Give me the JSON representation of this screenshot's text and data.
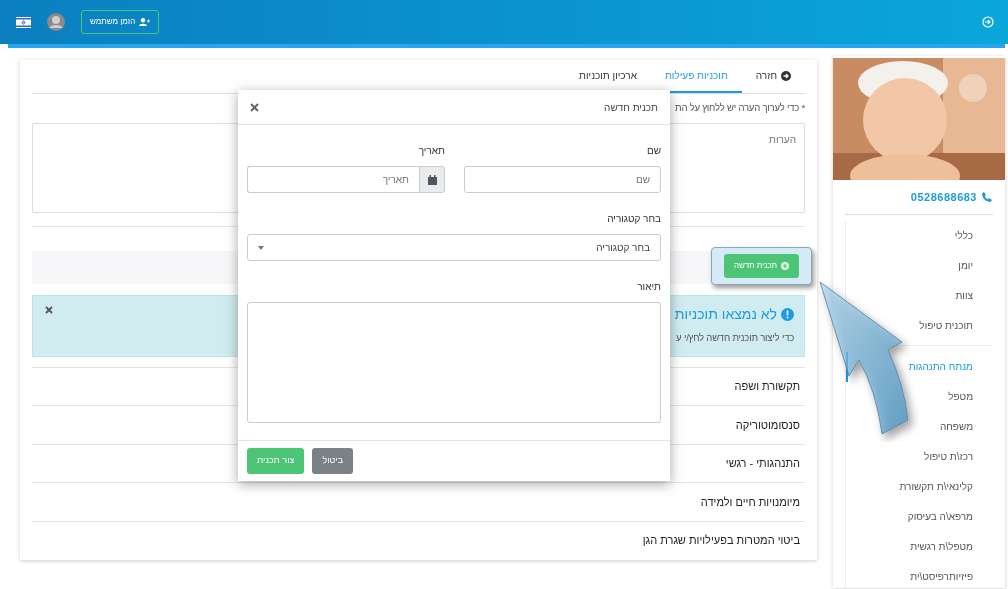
{
  "top_bar": {
    "invite_button": "הזמן משתמש"
  },
  "tabs": [
    {
      "label": "חזרה",
      "kind": "back",
      "selected": false
    },
    {
      "label": "תוכניות פעילות",
      "kind": "tab",
      "selected": true
    },
    {
      "label": "ארכיון תוכניות",
      "kind": "tab",
      "selected": false
    }
  ],
  "note": "* כדי לערוך הערה יש ללחוץ על הת",
  "notes_field": {
    "placeholder": "הערות"
  },
  "new_plan_button": "תכנית חדשה",
  "alert": {
    "title": "לא נמצאו תוכניות",
    "text": "כדי ליצור תוכנית חדשה לחץ/י ע"
  },
  "sections": [
    "תקשורת ושפה",
    "סנסומוטוריקה",
    "התנהגותי - רגשי",
    "מיומנויות חיים ולמידה",
    "ביטוי המטרות בפעילויות שגרת הגן"
  ],
  "sidebar": {
    "phone": "0528688683",
    "menu_groups": [
      {
        "items": [
          {
            "label": "כללי",
            "selected": false
          },
          {
            "label": "יומן",
            "selected": false
          },
          {
            "label": "צוות",
            "selected": false
          },
          {
            "label": "תוכנית טיפול",
            "selected": false
          }
        ]
      },
      {
        "items": [
          {
            "label": "מנתח התנהגות",
            "selected": true
          },
          {
            "label": "מטפל",
            "selected": false
          },
          {
            "label": "משפחה",
            "selected": false
          },
          {
            "label": "רכז\\ת טיפול",
            "selected": false
          },
          {
            "label": "קלינאי\\ת תקשורת",
            "selected": false
          },
          {
            "label": "מרפא\\ה בעיסוק",
            "selected": false
          },
          {
            "label": "מטפל\\ת רגשית",
            "selected": false
          },
          {
            "label": "פיזיותרפיסט\\ית",
            "selected": false
          }
        ]
      }
    ]
  },
  "modal": {
    "title": "תכנית חדשה",
    "name": {
      "label": "שם",
      "placeholder": "שם"
    },
    "date": {
      "label": "תאריך",
      "placeholder": "תאריך"
    },
    "category": {
      "label": "בחר קטגוריה",
      "value": "בחר קטגוריה"
    },
    "description": {
      "label": "תיאור"
    },
    "cancel_button": "ביטול",
    "create_button": "צור תכנית"
  }
}
